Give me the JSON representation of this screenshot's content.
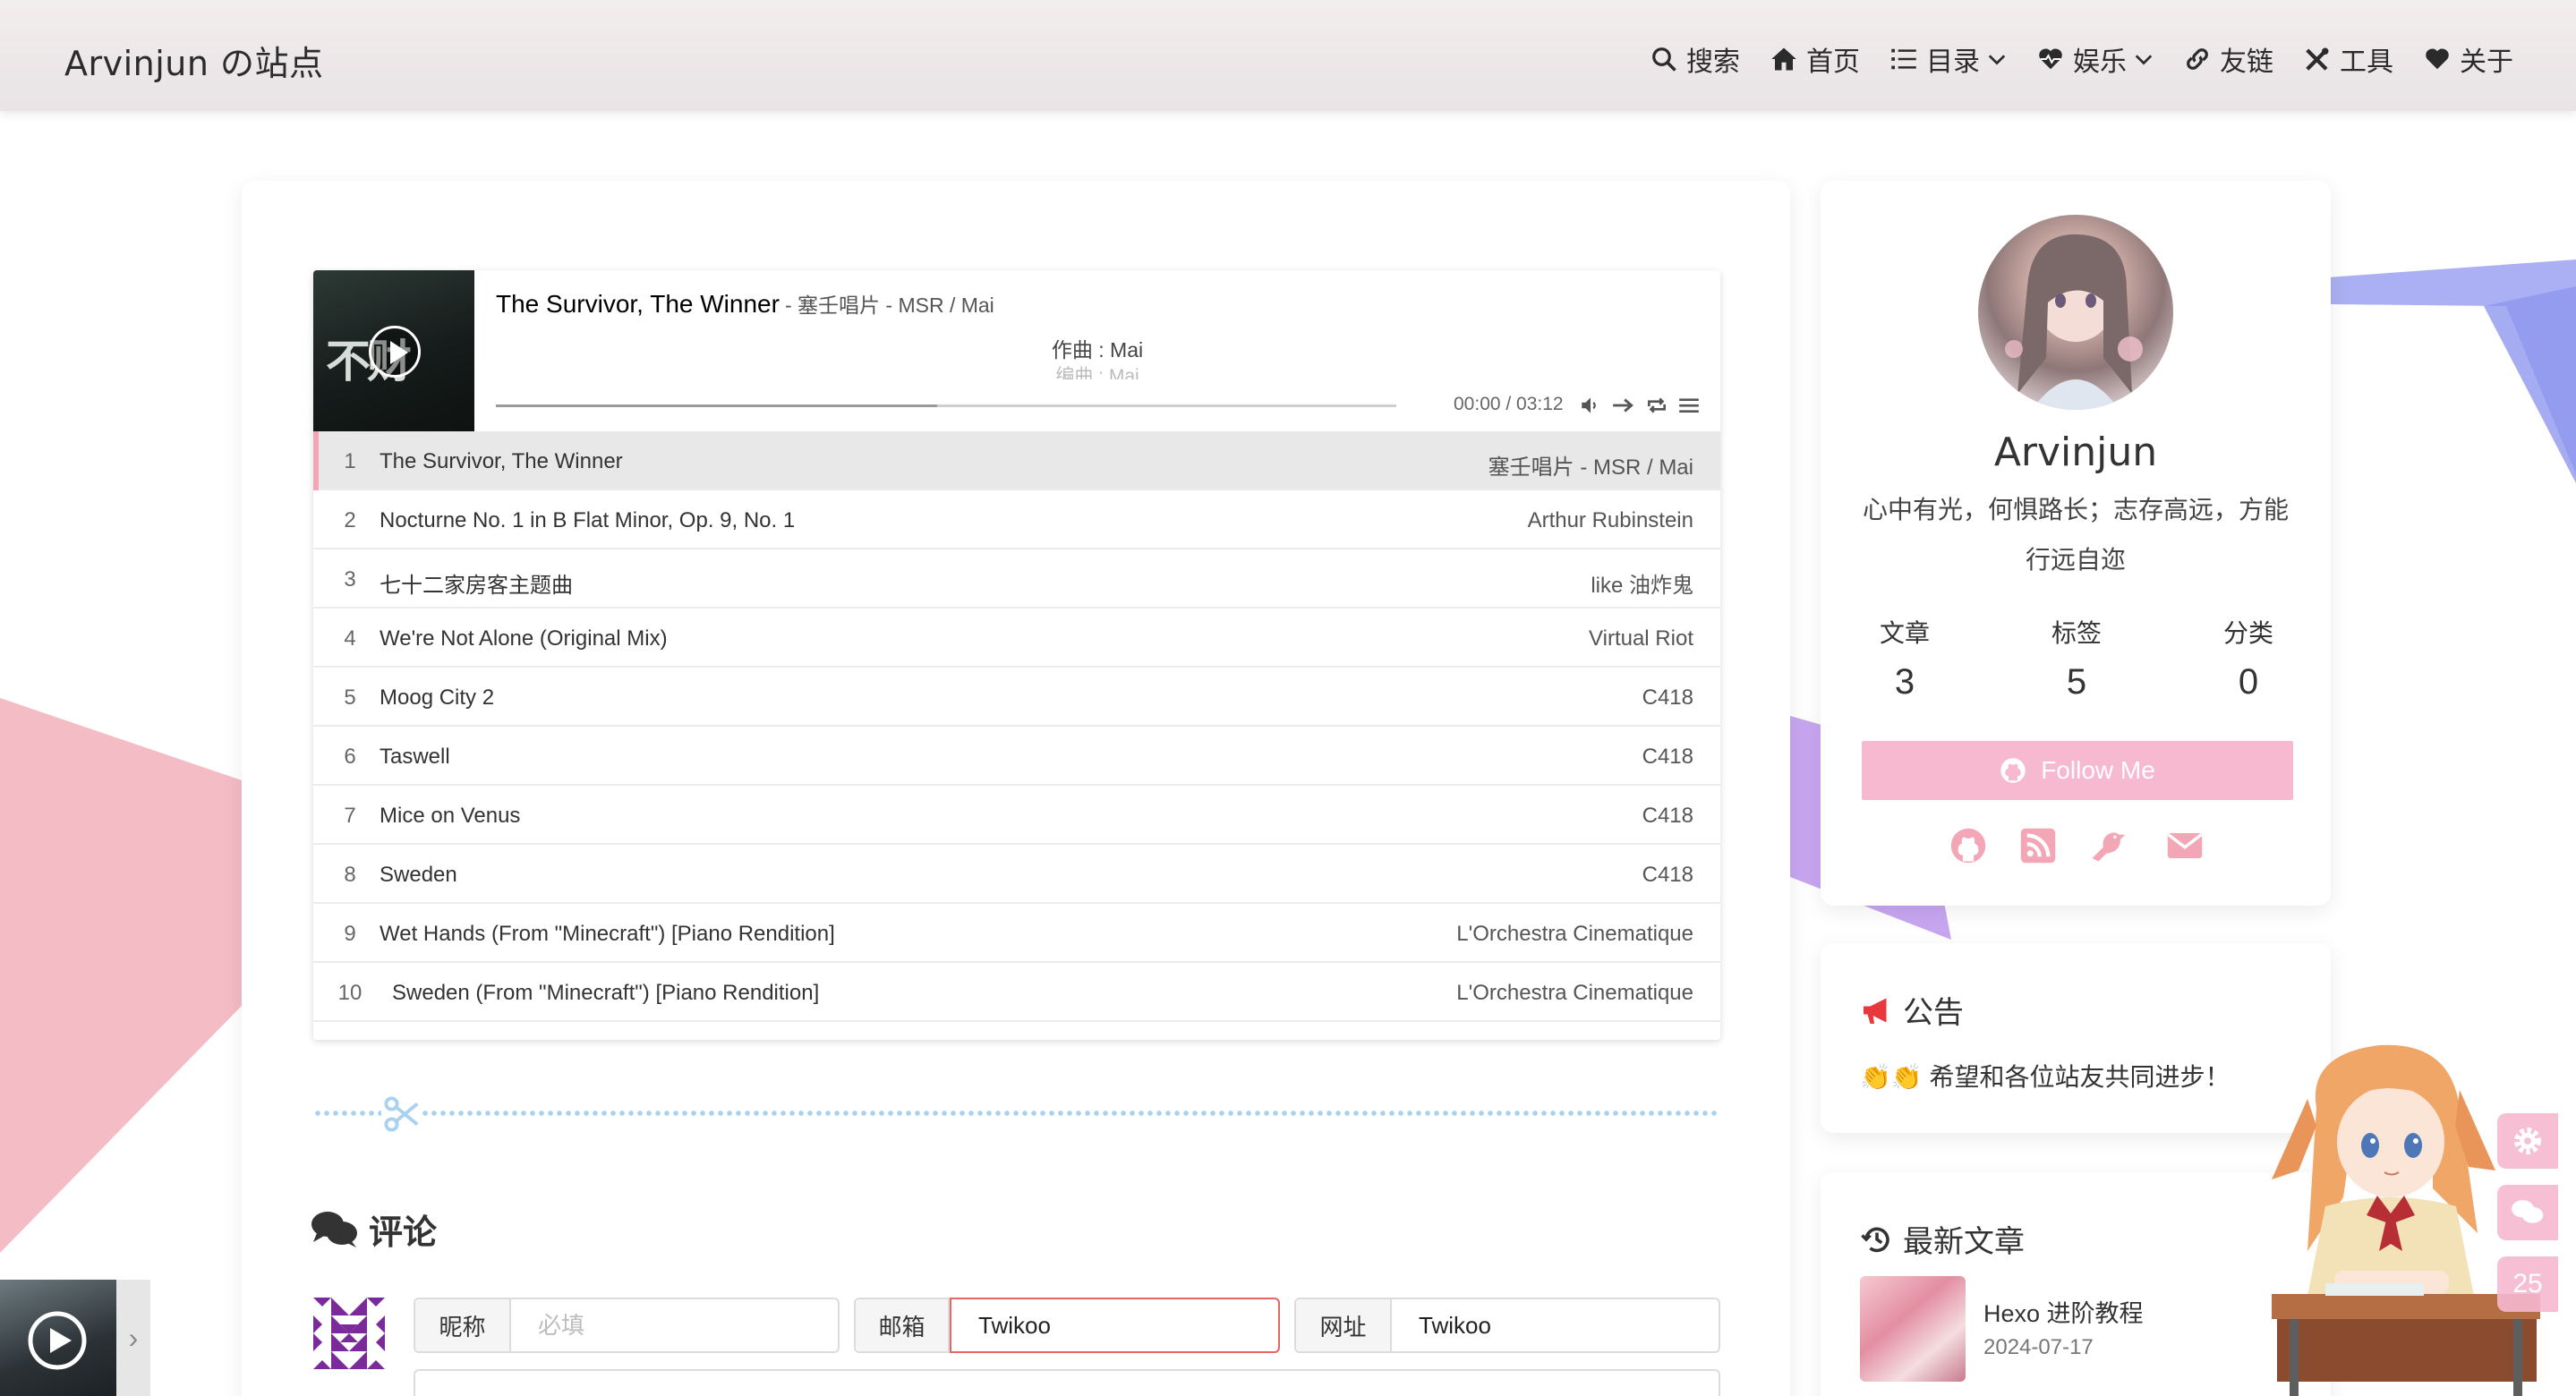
{
  "site": {
    "title": "Arvinjun の站点"
  },
  "nav": {
    "search": "搜索",
    "home": "首页",
    "catalog": "目录",
    "entertainment": "娱乐",
    "friends": "友链",
    "tools": "工具",
    "about": "关于"
  },
  "player": {
    "cover_text": "不财",
    "current_title": "The Survivor, The Winner",
    "current_artist": "- 塞壬唱片 - MSR / Mai",
    "lyric_line_1": "作曲 : Mai",
    "lyric_line_2": "编曲 : Mai",
    "time": "00:00 / 03:12",
    "progress_loaded": 0.49,
    "tracks": [
      {
        "num": "1",
        "name": "The Survivor, The Winner",
        "artist": "塞壬唱片 - MSR / Mai"
      },
      {
        "num": "2",
        "name": "Nocturne No. 1 in B Flat Minor, Op. 9, No. 1",
        "artist": "Arthur Rubinstein"
      },
      {
        "num": "3",
        "name": "七十二家房客主题曲",
        "artist": "like 油炸鬼"
      },
      {
        "num": "4",
        "name": "We're Not Alone (Original Mix)",
        "artist": "Virtual Riot"
      },
      {
        "num": "5",
        "name": "Moog City 2",
        "artist": "C418"
      },
      {
        "num": "6",
        "name": "Taswell",
        "artist": "C418"
      },
      {
        "num": "7",
        "name": "Mice on Venus",
        "artist": "C418"
      },
      {
        "num": "8",
        "name": "Sweden",
        "artist": "C418"
      },
      {
        "num": "9",
        "name": "Wet Hands (From \"Minecraft\") [Piano Rendition]",
        "artist": "L'Orchestra Cinematique"
      },
      {
        "num": "10",
        "name": "Sweden (From \"Minecraft\") [Piano Rendition]",
        "artist": "L'Orchestra Cinematique"
      }
    ]
  },
  "comments": {
    "title": "评论",
    "nick_label": "昵称",
    "nick_placeholder": "必填",
    "email_label": "邮箱",
    "email_value": "Twikoo",
    "url_label": "网址",
    "url_value": "Twikoo"
  },
  "profile": {
    "name": "Arvinjun",
    "bio_line1": "心中有光，何惧路长；志存高远，方能",
    "bio_line2": "行远自迩",
    "stats": [
      {
        "label": "文章",
        "value": "3"
      },
      {
        "label": "标签",
        "value": "5"
      },
      {
        "label": "分类",
        "value": "0"
      }
    ],
    "follow_label": "Follow Me"
  },
  "notice": {
    "title": "公告",
    "text": "👏👏 希望和各位站友共同进步！"
  },
  "recent": {
    "title": "最新文章",
    "post_title": "Hexo 进阶教程",
    "post_date": "2024-07-17"
  },
  "float": {
    "count": "25"
  },
  "colors": {
    "accent_pink": "#f6b9cf",
    "active_marker": "#f3a7b6",
    "divider_blue": "#a8d2ef",
    "notice_red": "#e8383d"
  }
}
